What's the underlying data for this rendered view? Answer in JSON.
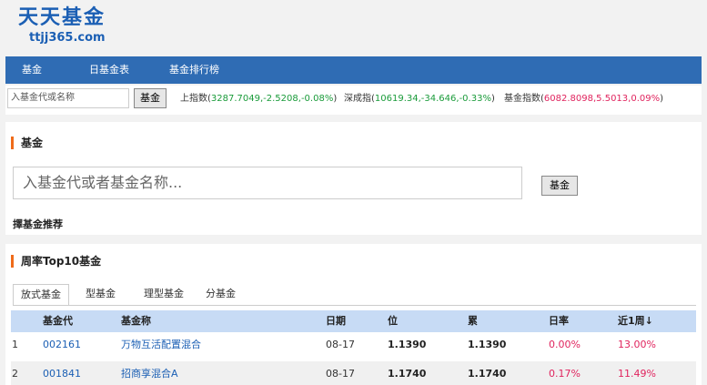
{
  "brand": {
    "title_cn": "天天基金",
    "domain": "ttjj365.com"
  },
  "nav": {
    "items": [
      "基金",
      "日基金表",
      "基金排行榜"
    ]
  },
  "quick_search": {
    "placeholder": "入基金代或名称",
    "button": "基金",
    "indices": [
      {
        "name": "上指数",
        "open": "(",
        "value": "3287.7049,-2.5208,-0.08%",
        "close": ")",
        "trend": "down"
      },
      {
        "name": "深成指",
        "open": "(",
        "value": "10619.34,-34.646,-0.33%",
        "close": ")",
        "trend": "down"
      },
      {
        "name": "基金指数",
        "open": "(",
        "value": "6082.8098,5.5013,0.09%",
        "close": ")",
        "trend": "up"
      }
    ]
  },
  "fund_search": {
    "title": "基金",
    "placeholder": "入基金代或者基金名称...",
    "button": "基金",
    "recommend": "擇基金推荐"
  },
  "top10": {
    "title": "周率Top10基金",
    "tabs": [
      "放式基金",
      "型基金",
      "理型基金",
      "分基金"
    ],
    "active_tab": 0,
    "columns": [
      "基金代",
      "基金称",
      "日期",
      "位",
      "累",
      "日率",
      "近1周↓"
    ],
    "rows": [
      {
        "rank": "1",
        "code": "002161",
        "name": "万物互活配置混合",
        "date": "08-17",
        "nav": "1.1390",
        "acc_nav": "1.1390",
        "daily": "0.00%",
        "week": "13.00%"
      },
      {
        "rank": "2",
        "code": "001841",
        "name": "招商享混合A",
        "date": "08-17",
        "nav": "1.1740",
        "acc_nav": "1.1740",
        "daily": "0.17%",
        "week": "11.49%"
      }
    ]
  },
  "colors": {
    "brand_blue": "#1b5fb4",
    "nav_bg": "#2f6cb4",
    "up_red": "#e0245e",
    "down_green": "#1a9b3a",
    "accent_orange": "#ef6b1a"
  }
}
